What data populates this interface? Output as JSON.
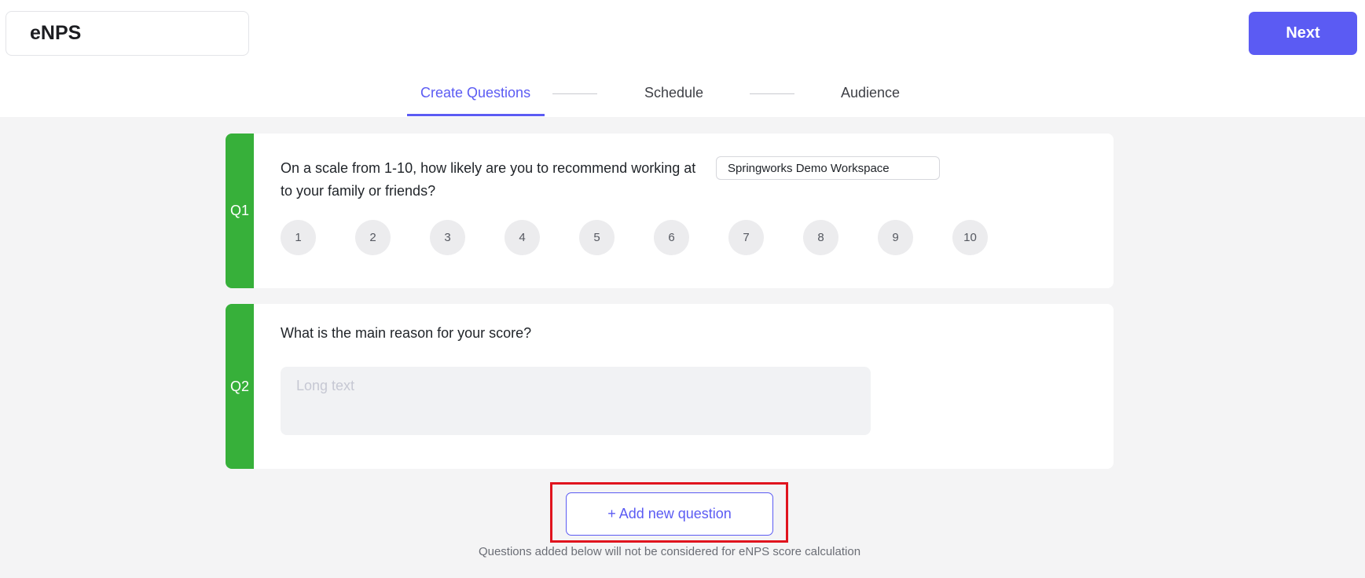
{
  "header": {
    "title": "eNPS",
    "next_label": "Next"
  },
  "steps": [
    {
      "label": "Create Questions",
      "active": true
    },
    {
      "label": "Schedule",
      "active": false
    },
    {
      "label": "Audience",
      "active": false
    }
  ],
  "questions": {
    "q1": {
      "tag": "Q1",
      "text": "On a scale from 1-10, how likely are you to recommend working at",
      "text_cont": "to your family or friends?",
      "workspace_value": "Springworks Demo Workspace",
      "scale": [
        "1",
        "2",
        "3",
        "4",
        "5",
        "6",
        "7",
        "8",
        "9",
        "10"
      ]
    },
    "q2": {
      "tag": "Q2",
      "text": "What is the main reason for your score?",
      "placeholder": "Long text"
    }
  },
  "actions": {
    "add_question_label": "+ Add new question",
    "note": "Questions added below will not be considered for eNPS score calculation"
  },
  "colors": {
    "accent": "#5b5bf3",
    "question_tag": "#37b03a",
    "highlight": "#e0141e"
  }
}
